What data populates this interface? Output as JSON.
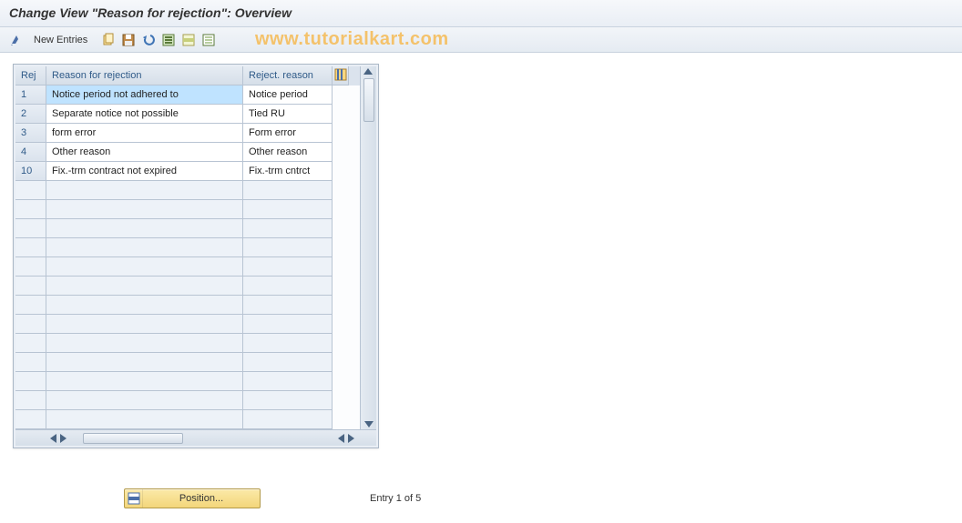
{
  "title": "Change View \"Reason for rejection\": Overview",
  "watermark": "www.tutorialkart.com",
  "toolbar": {
    "new_entries": "New Entries"
  },
  "table": {
    "headers": {
      "rej": "Rej",
      "reason": "Reason for rejection",
      "short": "Reject. reason"
    },
    "rows": [
      {
        "rej": "1",
        "reason": "Notice period not adhered to",
        "short": "Notice period",
        "selected": true
      },
      {
        "rej": "2",
        "reason": "Separate notice not possible",
        "short": "Tied RU"
      },
      {
        "rej": "3",
        "reason": "form error",
        "short": "Form error"
      },
      {
        "rej": "4",
        "reason": "Other reason",
        "short": "Other reason"
      },
      {
        "rej": "10",
        "reason": "Fix.-trm contract not expired",
        "short": "Fix.-trm cntrct"
      }
    ]
  },
  "position_button": "Position...",
  "entry_status": "Entry 1 of 5",
  "empty_rows": 13,
  "colors": {
    "accent": "#2f5a88",
    "select_bg": "#bfe3ff",
    "gold": "#f3d67a"
  }
}
